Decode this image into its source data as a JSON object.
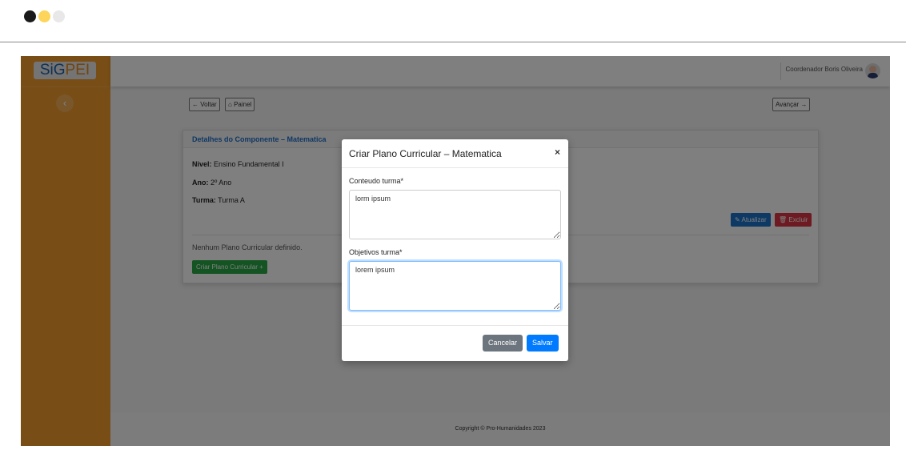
{
  "window": {
    "dots": [
      "#1a1a1a",
      "#fdd55a",
      "#e8e8e8"
    ]
  },
  "sidebar": {
    "logo_a": "SiG",
    "logo_b": "PEI",
    "collapse": "‹"
  },
  "header": {
    "user": "Coordenador Boris Oliveira"
  },
  "nav": {
    "back": "← Voltar",
    "panel": "Painel",
    "next": "Avançar →"
  },
  "card": {
    "title": "Detalhes do Componente – Matematica",
    "nivel_label": "Nivel:",
    "nivel": " Ensino Fundamental I",
    "ano_label": "Ano:",
    "ano": " 2º Ano",
    "turma_label": "Turma:",
    "turma": " Turma A",
    "update": "Atualizar",
    "delete": "Excluir",
    "empty": "Nenhum Plano Curricular definido.",
    "create": "Criar Plano Curricular +"
  },
  "footer": {
    "text": "Copyright © Pro-Humanidades 2023"
  },
  "modal": {
    "title": "Criar Plano Curricular – Matematica",
    "close": "×",
    "conteudo_label": "Conteudo turma*",
    "conteudo_value": "lorm ipsum",
    "objetivos_label": "Objetivos turma*",
    "objetivos_value": "lorem ipsum",
    "cancel": "Cancelar",
    "save": "Salvar"
  }
}
